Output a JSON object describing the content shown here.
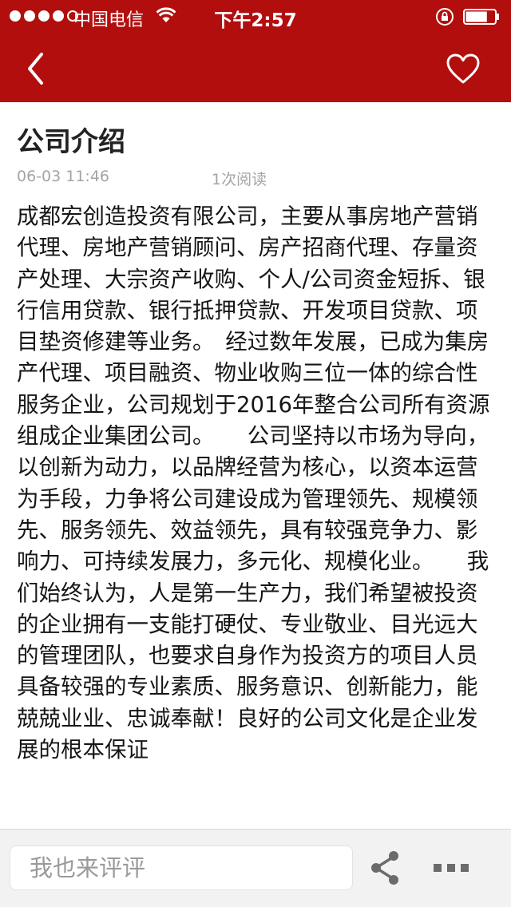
{
  "status_bar": {
    "carrier": "中国电信",
    "time": "下午2:57",
    "signal_icon": "signal-dots-icon",
    "wifi_icon": "wifi-icon",
    "lock_icon": "rotation-lock-icon",
    "battery_icon": "battery-icon",
    "battery_level": 0.75
  },
  "nav": {
    "back_icon": "chevron-left-icon",
    "favorite_icon": "heart-outline-icon"
  },
  "article": {
    "title": "公司介绍",
    "date": "06-03  11:46",
    "reads": "1次阅读",
    "body": "成都宏创造投资有限公司，主要从事房地产营销代理、房地产营销顾问、房产招商代理、存量资产处理、大宗资产收购、个人/公司资金短拆、银行信用贷款、银行抵押贷款、开发项目贷款、项目垫资修建等业务。　经过数年发展，已成为集房产代理、项目融资、物业收购三位一体的综合性服务企业，公司规划于2016年整合公司所有资源组成企业集团公司。　　公司坚持以市场为导向，以创新为动力，以品牌经营为核心，以资本运营为手段，力争将公司建设成为管理领先、规模领先、服务领先、效益领先，具有较强竞争力、影响力、可持续发展力，多元化、规模化业。　　我们始终认为，人是第一生产力，我们希望被投资的企业拥有一支能打硬仗、专业敬业、目光远大的管理团队，也要求自身作为投资方的项目人员具备较强的专业素质、服务意识、创新能力，能兢兢业业、忠诚奉献！良好的公司文化是企业发展的根本保证"
  },
  "toolbar": {
    "comment_placeholder": "我也来评评",
    "share_icon": "share-icon",
    "more_icon": "more-dots-icon"
  },
  "colors": {
    "brand_red": "#b30e0e",
    "toolbar_bg": "#f2f2f2",
    "meta_gray": "#a4a4a4"
  }
}
